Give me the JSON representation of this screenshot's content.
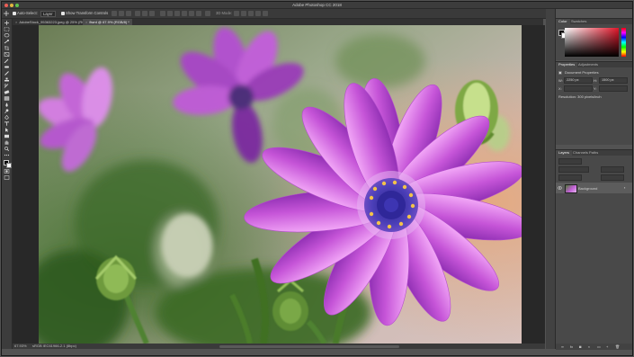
{
  "app": {
    "title": "Adobe Photoshop CC 2018"
  },
  "options_bar": {
    "auto_select_label": "Auto-Select:",
    "auto_select_value": "Layer",
    "transform_label": "Show Transform Controls",
    "mode_3d_label": "3D Mode:"
  },
  "doc_tabs": [
    {
      "label": "AdobeStock_95363223.jpeg @ 25% (RGB/8)",
      "active": false
    },
    {
      "label": "flwrd @ 67.9% (RGB/8) *",
      "active": true
    }
  ],
  "status_bar": {
    "zoom": "67.93%",
    "info": "sRGB IEC61966-2.1 (8bpc)"
  },
  "color_panel": {
    "tabs": [
      "Color",
      "Swatches"
    ],
    "foreground": "#000000",
    "background": "#ffffff",
    "hue_color": "#e2162a"
  },
  "properties_panel": {
    "tabs": [
      "Properties",
      "Adjustments"
    ],
    "section_title": "Document Properties",
    "width_label": "W:",
    "width_value": "2250 px",
    "height_label": "H:",
    "height_value": "1500 px",
    "x_label": "X:",
    "y_label": "Y:",
    "resolution": "Resolution: 300 pixels/inch"
  },
  "layers_panel": {
    "tabs": [
      "Layers",
      "Channels",
      "Paths"
    ],
    "layer_name": "Background"
  },
  "photo": {
    "subject": "purple daisy",
    "colors": {
      "petal": "#c54fd8",
      "center": "#3a2a9a",
      "foliage": "#4b7a2f"
    }
  }
}
